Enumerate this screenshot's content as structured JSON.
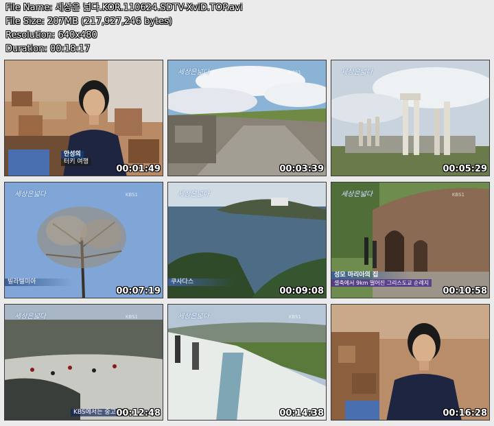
{
  "file_info": {
    "file_name": "File Name: 세상은 넓다.KOR.110624.SDTV-XviD.TOP.avi",
    "file_size": "File Size: 207MB (217,927,246 bytes)",
    "resolution": "Resolution: 640x480",
    "duration": "Duration: 00:18:17"
  },
  "thumbnails": [
    {
      "time": "00:01:49",
      "caption_name": "안성의",
      "caption_sub": "터키 여행",
      "logo": "",
      "kbs": ""
    },
    {
      "time": "00:03:39",
      "logo": "세상은넓다",
      "kbs": "KBS1"
    },
    {
      "time": "00:05:29",
      "logo": "세상은넓다",
      "kbs": ""
    },
    {
      "time": "00:07:19",
      "logo": "세상은넓다",
      "kbs": "KBS1",
      "caption": "빌라텔미아"
    },
    {
      "time": "00:09:08",
      "logo": "세상은넓다",
      "kbs": "",
      "caption": "쿠사다스"
    },
    {
      "time": "00:10:58",
      "logo": "세상은넓다",
      "kbs": "KBS1",
      "caption": "성모 마리아의 집",
      "caption_sub": "셀축에서 9km 떨어진 그리스도교 순례지"
    },
    {
      "time": "00:12:48",
      "logo": "세상은넓다",
      "kbs": "KBS1",
      "caption": "KBS에서는 중고등"
    },
    {
      "time": "00:14:38",
      "logo": "세상은넓다",
      "kbs": "KBS1"
    },
    {
      "time": "00:16:28",
      "logo": "",
      "kbs": ""
    }
  ]
}
